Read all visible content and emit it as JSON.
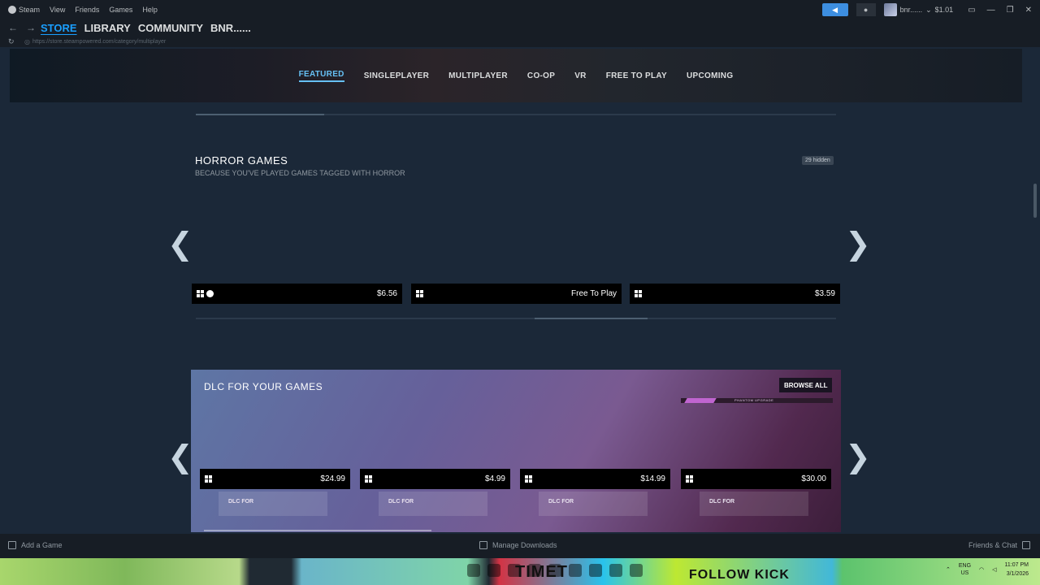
{
  "titlebar": {
    "app_name": "Steam",
    "menu": [
      "View",
      "Friends",
      "Games",
      "Help"
    ],
    "account_name": "bnr......",
    "wallet": "$1.01"
  },
  "nav": {
    "links": [
      "STORE",
      "LIBRARY",
      "COMMUNITY",
      "BNR......"
    ],
    "active": "STORE",
    "url": "https://store.steampowered.com/category/multiplayer"
  },
  "store_tabs": [
    "FEATURED",
    "SINGLEPLAYER",
    "MULTIPLAYER",
    "CO-OP",
    "VR",
    "FREE TO PLAY",
    "UPCOMING"
  ],
  "horror": {
    "title": "HORROR GAMES",
    "subtitle": "BECAUSE YOU'VE PLAYED GAMES TAGGED WITH HORROR",
    "hidden_badge": "29 hidden",
    "items": [
      {
        "platforms": [
          "windows-icon",
          "steam-icon"
        ],
        "price": "$6.56"
      },
      {
        "platforms": [
          "windows-icon"
        ],
        "price": "Free To Play"
      },
      {
        "platforms": [
          "windows-icon"
        ],
        "price": "$3.59"
      }
    ]
  },
  "dlc": {
    "title": "DLC FOR YOUR GAMES",
    "browse_all": "BROWSE ALL",
    "promo_text": "PHANTOM UPGRADE",
    "items": [
      {
        "price": "$24.99",
        "label": "DLC FOR"
      },
      {
        "price": "$4.99",
        "label": "DLC FOR"
      },
      {
        "price": "$14.99",
        "label": "DLC FOR"
      },
      {
        "price": "$30.00",
        "label": "DLC FOR"
      }
    ]
  },
  "bottombar": {
    "add_game": "Add a Game",
    "manage_downloads": "Manage Downloads",
    "friends_chat": "Friends & Chat"
  },
  "taskbar": {
    "banner_left": "TIMET",
    "banner_right": "FOLLOW KICK",
    "lang_top": "ENG",
    "lang_bottom": "US",
    "time": "11:07 PM",
    "date": "3/1/2026"
  },
  "colors": {
    "accent": "#1a9fff",
    "tab_active": "#66c0f4",
    "page_bg": "#1b2838"
  }
}
